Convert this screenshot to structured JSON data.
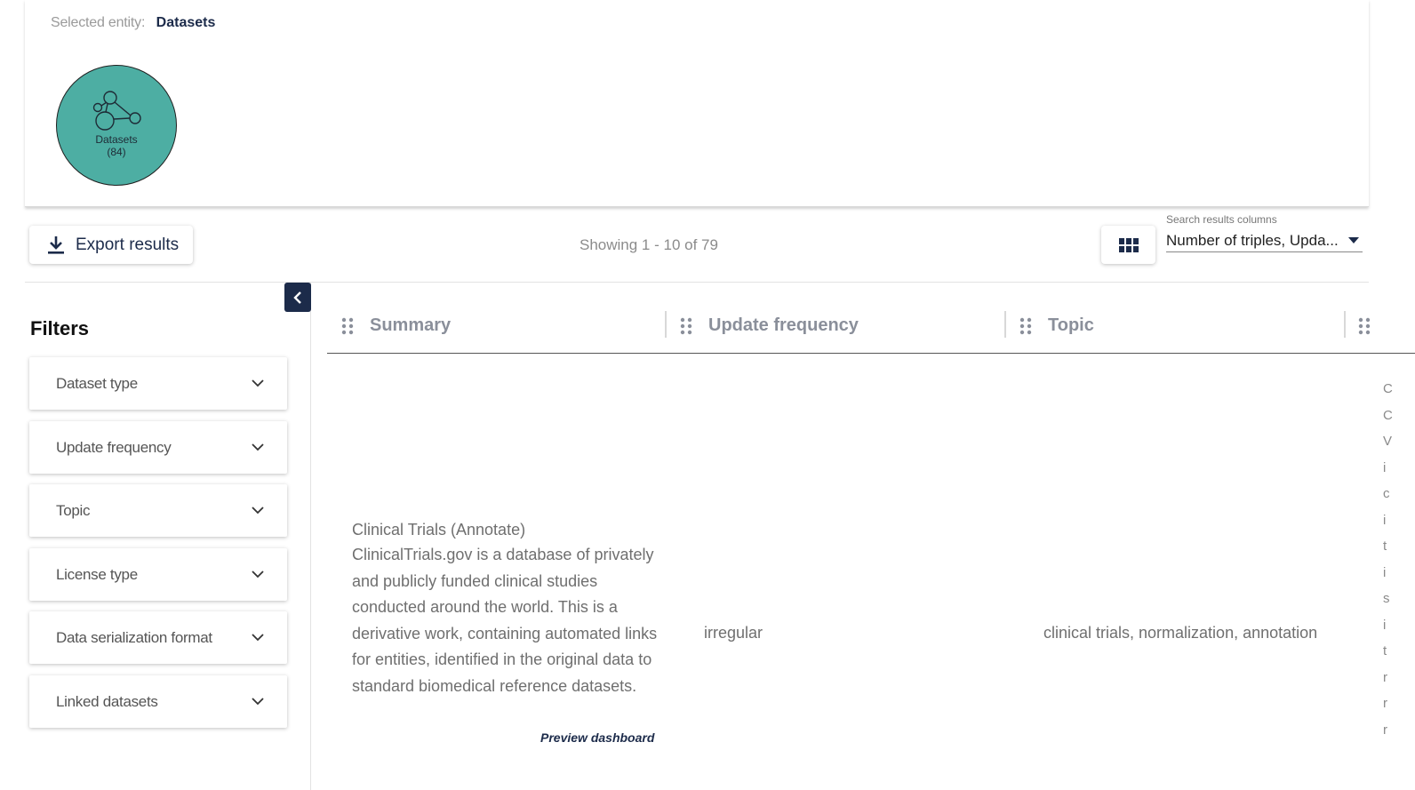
{
  "entity_panel": {
    "selected_label": "Selected entity:",
    "selected_value": "Datasets",
    "bubble_name": "Datasets",
    "bubble_count": "(84)",
    "bubble_color": "#4daea3"
  },
  "toolbar": {
    "export_label": "Export results",
    "showing_text": "Showing 1 - 10 of 79",
    "columns_caption": "Search results columns",
    "columns_value": "Number of triples, Upda..."
  },
  "filters": {
    "title": "Filters",
    "items": [
      {
        "label": "Dataset type"
      },
      {
        "label": "Update frequency"
      },
      {
        "label": "Topic"
      },
      {
        "label": "License type"
      },
      {
        "label": "Data serialization format"
      },
      {
        "label": "Linked datasets"
      }
    ]
  },
  "table": {
    "columns": [
      "Summary",
      "Update frequency",
      "Topic"
    ],
    "rows": [
      {
        "title": "Clinical Trials (Annotate)",
        "description": "ClinicalTrials.gov is a database of privately and publicly funded clinical studies conducted around the world. This is a derivative work, containing automated links for entities, identified in the original data to standard biomedical reference datasets.",
        "preview_label": "Preview dashboard",
        "update_frequency": "irregular",
        "topic": "clinical trials, normalization, annotation"
      }
    ],
    "clipped_column_letters": [
      "C",
      "C",
      "V",
      "i",
      "c",
      "i",
      "t",
      "i",
      "s",
      "i",
      "t",
      "r",
      "r",
      "r"
    ]
  },
  "colors": {
    "navy": "#1c2b4a",
    "teal": "#4daea3"
  }
}
